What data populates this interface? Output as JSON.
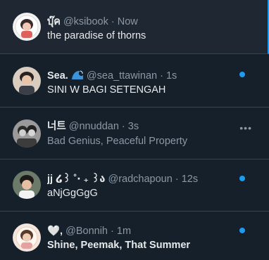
{
  "feed": {
    "tweets": [
      {
        "name": "บุ๊ค",
        "handle": "@ksibook",
        "separator": "·",
        "time": "Now",
        "text": "the paradise of thorns",
        "muted_text": false,
        "unread": false,
        "active": true
      },
      {
        "name": "Sea.",
        "name_emoji": "wave-icon",
        "handle": "@sea_ttawinan",
        "separator": "·",
        "time": "1s",
        "text": "SINI W BAGI SETENGAH",
        "muted_text": false,
        "unread": true,
        "active": false
      },
      {
        "name": "너트",
        "handle": "@nnuddan",
        "separator": "·",
        "time": "3s",
        "text": "Bad Genius, Peaceful Property",
        "muted_text": true,
        "unread": false,
        "more_icon": "more-horizontal-icon",
        "active": false
      },
      {
        "name": "jj ໒꒱ ˚‧ ₊ ꒱ა",
        "handle": "@radchapoun",
        "separator": "·",
        "time": "12s",
        "text": "aNjGgGgG",
        "muted_text": false,
        "unread": true,
        "active": false
      },
      {
        "name": "🤍,",
        "handle": "@Bonnih",
        "separator": "·",
        "time": "1m",
        "text": "Shine, Peemak, That Summer",
        "muted_text": false,
        "unread": true,
        "active": false
      }
    ]
  },
  "colors": {
    "background": "#15202b",
    "active_background": "#1e2732",
    "accent": "#1d9bf0",
    "secondary_text": "#8b98a5",
    "primary_text": "#e7e9ea",
    "divider": "#38444d"
  }
}
